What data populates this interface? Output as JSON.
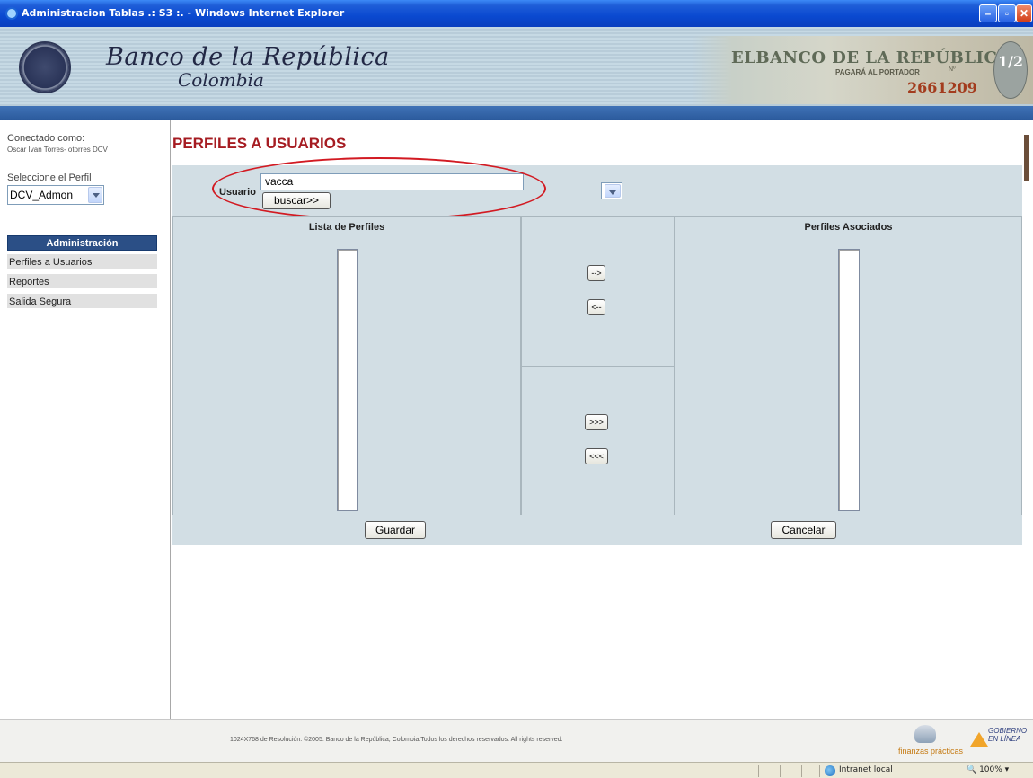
{
  "window": {
    "title": "Administracion Tablas .: S3 :. - Windows Internet Explorer"
  },
  "banner": {
    "brand_line1": "Banco de la República",
    "brand_line2": "Colombia",
    "bill_title": "ELBANCO DE LA REPÚBLICA",
    "bill_sub": "PAGARÁ AL PORTADOR",
    "bill_no": "Nº",
    "bill_number": "2661209",
    "bill_coin": "1/2"
  },
  "sidebar": {
    "connected_label": "Conectado como:",
    "connected_user": "Oscar Ivan Torres- otorres DCV",
    "profile_label": "Seleccione el Perfil",
    "profile_value": "DCV_Admon",
    "admin_header": "Administración",
    "menu": [
      {
        "label": "Perfiles a Usuarios"
      },
      {
        "label": "Reportes"
      },
      {
        "label": "Salida Segura"
      }
    ]
  },
  "main": {
    "title": "PERFILES A USUARIOS",
    "usuario_label": "Usuario",
    "usuario_value": "vacca",
    "search_button": "buscar>>",
    "list_title": "Lista de Perfiles",
    "assoc_title": "Perfiles Asociados",
    "move_right": "-->",
    "move_left": "<--",
    "move_all_right": ">>>",
    "move_all_left": "<<<",
    "save_button": "Guardar",
    "cancel_button": "Cancelar"
  },
  "footer": {
    "text": "1024X768 de Resolución. ©2005. Banco de la República, Colombia.Todos los derechos reservados. All rights reserved.",
    "logo1": "finanzas prácticas",
    "logo2_line1": "GOBIERNO",
    "logo2_line2": "EN LÍNEA"
  },
  "statusbar": {
    "zone": "Intranet local",
    "zoom": "100%"
  },
  "colors": {
    "title_red": "#a61c22",
    "panel_bg": "#d2dee4",
    "admin_header_bg": "#2b4f86",
    "highlight_oval": "#d21a22"
  }
}
